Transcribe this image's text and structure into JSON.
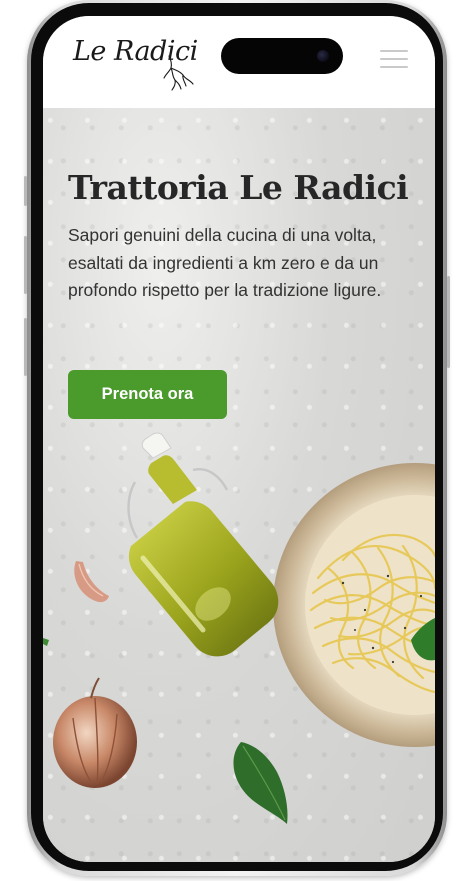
{
  "header": {
    "logo_text": "Le Radici",
    "menu_icon": "hamburger-menu-icon"
  },
  "hero": {
    "title": "Trattoria Le Radici",
    "subtitle": "Sapori genuini della cucina di una volta, esaltati da ingredienti a km zero e da un profondo rispetto per la tradizione ligure.",
    "cta_label": "Prenota ora"
  },
  "colors": {
    "accent": "#4a9a2c",
    "header_bg": "#ffffff",
    "text_dark": "#272727"
  }
}
